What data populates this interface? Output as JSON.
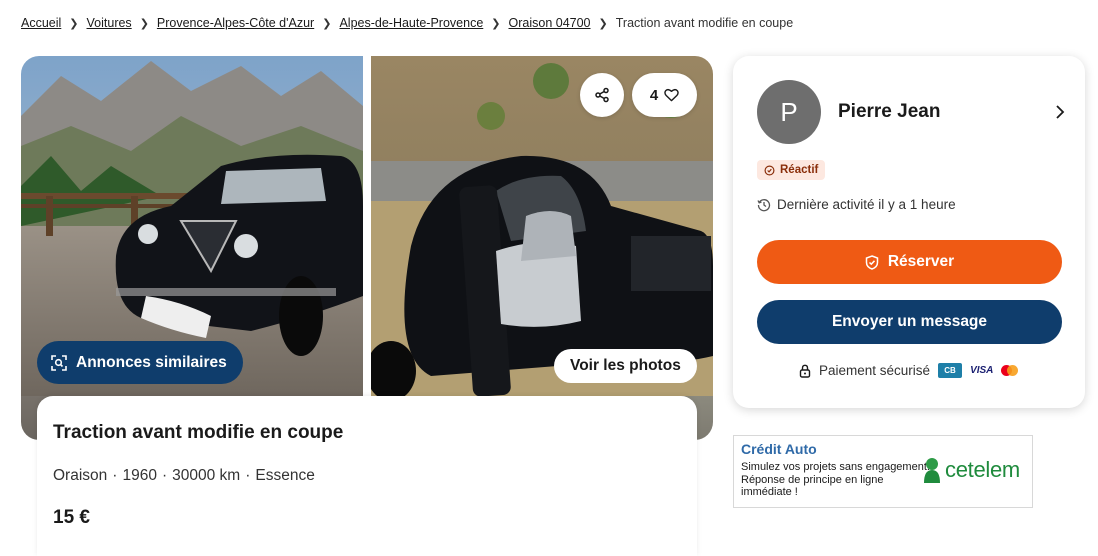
{
  "breadcrumb": {
    "items": [
      "Accueil",
      "Voitures",
      "Provence-Alpes-Côte d'Azur",
      "Alpes-de-Haute-Provence",
      "Oraison 04700"
    ],
    "current": "Traction avant modifie en coupe"
  },
  "gallery": {
    "favorites_count": "4",
    "similar_label": "Annonces similaires",
    "photos_label": "Voir les photos"
  },
  "listing": {
    "title": "Traction avant modifie en coupe",
    "location": "Oraison",
    "year": "1960",
    "mileage": "30000 km",
    "fuel": "Essence",
    "price": "15 €"
  },
  "seller": {
    "initial": "P",
    "name": "Pierre Jean",
    "badge": "Réactif",
    "activity": "Dernière activité il y a 1 heure",
    "reserve_label": "Réserver",
    "message_label": "Envoyer un message",
    "payment_label": "Paiement sécurisé",
    "payment_methods": [
      "CB",
      "VISA",
      "Mastercard"
    ]
  },
  "ad": {
    "title": "Crédit Auto",
    "body": "Simulez vos projets sans engagement. Réponse de principe en ligne immédiate !",
    "brand": "cetelem"
  },
  "colors": {
    "primary_blue": "#0f3d6c",
    "accent_orange": "#ef5a14",
    "badge_bg": "#fde8e0",
    "cetelem_green": "#1f8b3d"
  }
}
